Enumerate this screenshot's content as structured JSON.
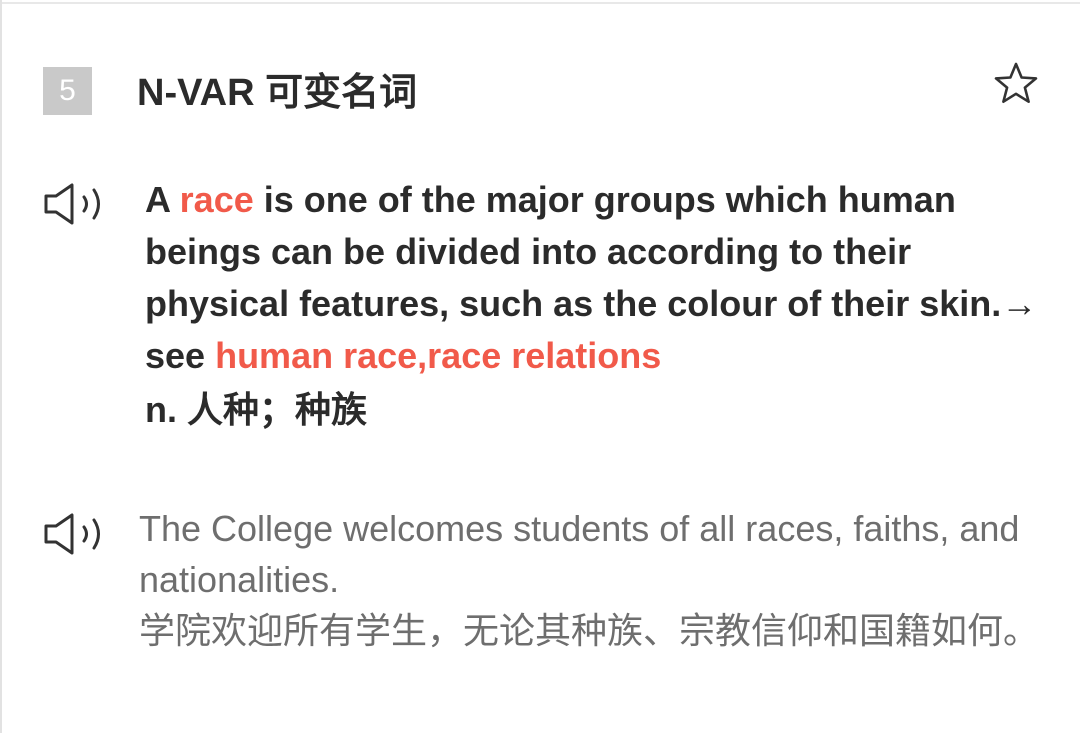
{
  "sense": {
    "number": "5",
    "pos_label": "N-VAR 可变名词",
    "star_icon": "star-outline-icon"
  },
  "definition": {
    "speaker_icon": "speaker-icon",
    "text_a": "A ",
    "headword": "race",
    "text_b": " is one of the major groups which human beings can be divided into according to their physical features, such as the colour of their skin.→ see ",
    "see_also": "human race,race relations",
    "translation": "n. 人种；种族"
  },
  "example": {
    "speaker_icon": "speaker-icon",
    "sentence": "The College welcomes students of all races, faiths, and nationalities.",
    "translation": "学院欢迎所有学生，无论其种族、宗教信仰和国籍如何。"
  },
  "colors": {
    "highlight": "#f15a4a",
    "text_dark": "#2b2b2b",
    "text_gray": "#6e6e6e",
    "badge": "#c9c9c9"
  }
}
